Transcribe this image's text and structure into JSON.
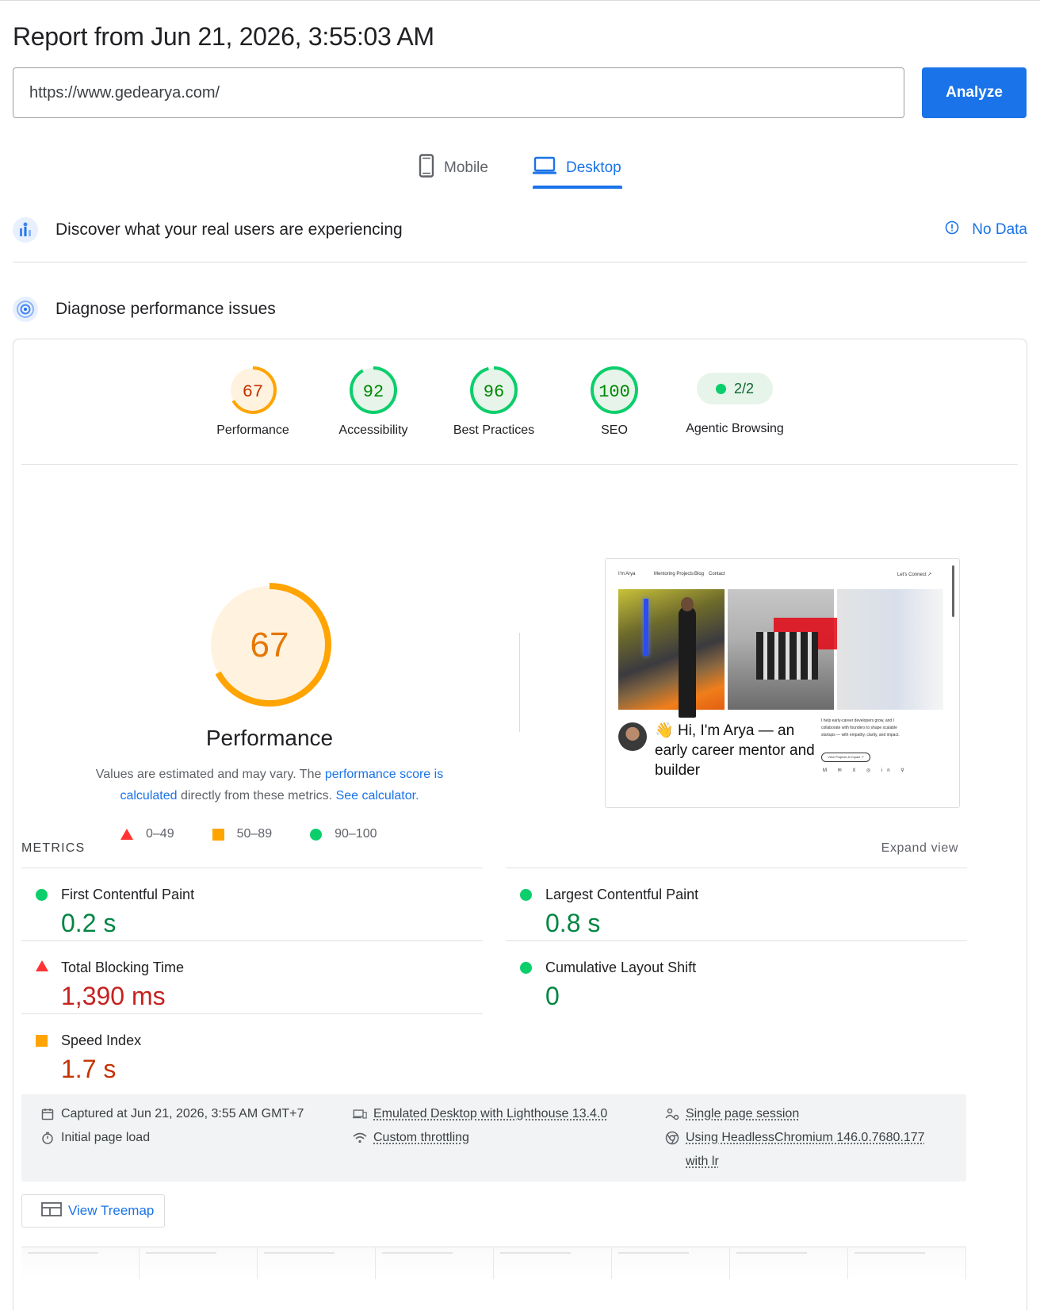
{
  "report": {
    "title": "Report from Jun 21, 2026, 3:55:03 AM"
  },
  "url_bar": {
    "value": "https://www.gedearya.com/",
    "analyze_label": "Analyze"
  },
  "device_tabs": {
    "mobile_label": "Mobile",
    "desktop_label": "Desktop",
    "selected": "Desktop"
  },
  "crux": {
    "title": "Discover what your real users are experiencing",
    "no_data_label": "No Data"
  },
  "diagnose": {
    "title": "Diagnose performance issues"
  },
  "gauges": [
    {
      "label": "Performance",
      "score": "67",
      "value": 67,
      "color": "#ffa400",
      "text_color": "#c33300",
      "bg": "#fff3e0"
    },
    {
      "label": "Accessibility",
      "score": "92",
      "value": 92,
      "color": "#0cce6b",
      "text_color": "#008800",
      "bg": "#e6f4ea"
    },
    {
      "label": "Best Practices",
      "score": "96",
      "value": 96,
      "color": "#0cce6b",
      "text_color": "#008800",
      "bg": "#e6f4ea"
    },
    {
      "label": "SEO",
      "score": "100",
      "value": 100,
      "color": "#0cce6b",
      "text_color": "#008800",
      "bg": "#e6f4ea"
    }
  ],
  "agentic": {
    "label": "Agentic Browsing",
    "value": "2/2"
  },
  "performance_detail": {
    "score": "67",
    "value": 67,
    "title": "Performance",
    "desc_prefix": "Values are estimated and may vary. The ",
    "desc_link1": "performance score is calculated",
    "desc_mid": " directly from these metrics. ",
    "desc_link2": "See calculator."
  },
  "legend": {
    "poor": "0–49",
    "average": "50–89",
    "good": "90–100"
  },
  "screenshot": {
    "nav_brand": "I'm Arya",
    "nav_links": [
      "Mentoring Projects",
      "Blog",
      "Contact"
    ],
    "nav_cta": "Let's Connect ↗",
    "headline_emoji": "👋",
    "headline": "Hi, I'm Arya — an early career mentor and builder",
    "side_text": "I help early-career developers grow, and I collaborate with founders to shape scalable startups — with empathy, clarity, and impact.",
    "side_button": "View Projects & Impact ↗"
  },
  "metrics": {
    "title": "METRICS",
    "expand_label": "Expand view",
    "items": [
      {
        "label": "First Contentful Paint",
        "value": "0.2 s",
        "rating": "good"
      },
      {
        "label": "Largest Contentful Paint",
        "value": "0.8 s",
        "rating": "good"
      },
      {
        "label": "Total Blocking Time",
        "value": "1,390 ms",
        "rating": "poor"
      },
      {
        "label": "Cumulative Layout Shift",
        "value": "0",
        "rating": "good"
      },
      {
        "label": "Speed Index",
        "value": "1.7 s",
        "rating": "average"
      }
    ]
  },
  "runtime": {
    "captured": "Captured at Jun 21, 2026, 3:55 AM GMT+7",
    "initial_load": "Initial page load",
    "emulated": "Emulated Desktop with Lighthouse 13.4.0",
    "throttling": "Custom throttling",
    "session": "Single page session",
    "browser": "Using HeadlessChromium 146.0.7680.177 with lr"
  },
  "treemap": {
    "label": "View Treemap"
  }
}
